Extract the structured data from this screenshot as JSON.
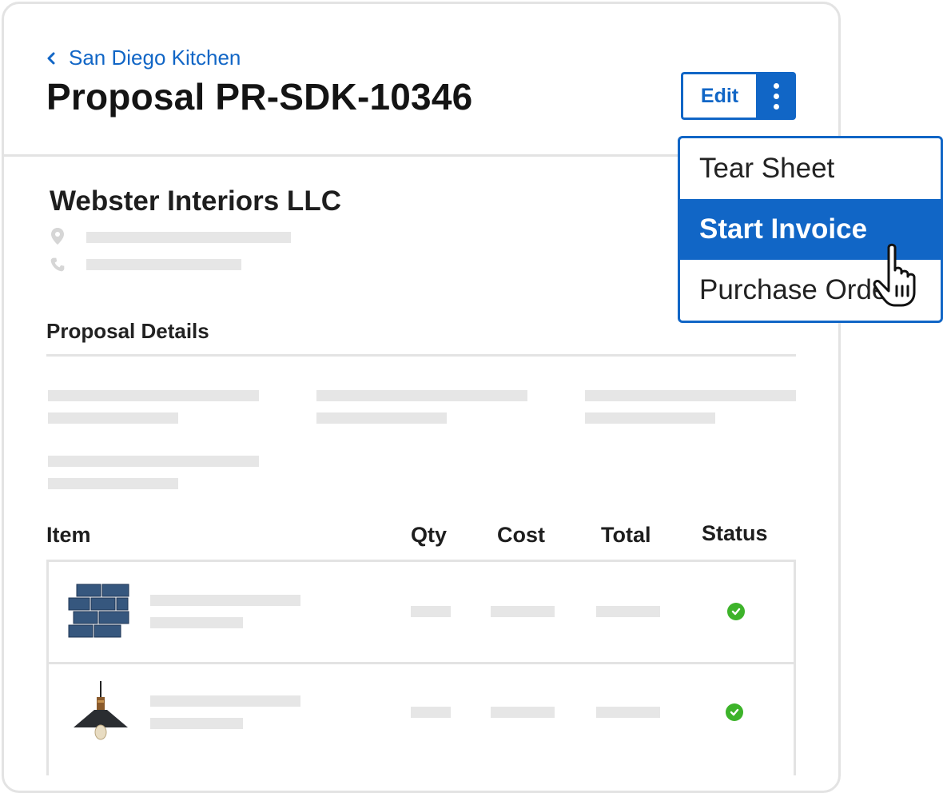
{
  "breadcrumb": {
    "label": "San Diego Kitchen",
    "icon": "chevron-left-icon"
  },
  "page": {
    "title": "Proposal PR-SDK-10346"
  },
  "actions": {
    "edit_label": "Edit",
    "more_icon": "kebab-menu-icon"
  },
  "menu": {
    "items": [
      {
        "label": "Tear Sheet",
        "active": false
      },
      {
        "label": "Start Invoice",
        "active": true
      },
      {
        "label": "Purchase Order",
        "active": false
      }
    ]
  },
  "client": {
    "name": "Webster Interiors LLC",
    "address_icon": "location-pin-icon",
    "phone_icon": "phone-icon"
  },
  "details": {
    "title": "Proposal Details"
  },
  "table": {
    "columns": [
      "Item",
      "Qty",
      "Cost",
      "Total",
      "Status"
    ],
    "rows": [
      {
        "thumbnail": "blue-subway-tile",
        "status_icon": "check-circle-icon"
      },
      {
        "thumbnail": "pendant-lamp",
        "status_icon": "check-circle-icon"
      }
    ]
  },
  "colors": {
    "accent": "#1166c6",
    "status_ok": "#3db32a",
    "placeholder": "#e6e6e6",
    "border": "#e3e3e3"
  }
}
